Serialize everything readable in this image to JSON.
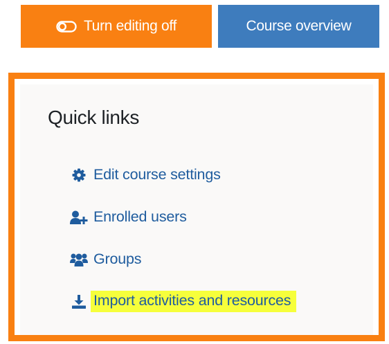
{
  "toolbar": {
    "edit_toggle": {
      "label": "Turn editing off",
      "icon": "toggle-icon",
      "color": "#f98012"
    },
    "course_overview": {
      "label": "Course overview",
      "color": "#3e7cbd"
    }
  },
  "quick_links": {
    "title": "Quick links",
    "border_color": "#f98012",
    "items": [
      {
        "label": "Edit course settings",
        "icon": "gear-icon"
      },
      {
        "label": "Enrolled users",
        "icon": "user-plus-icon"
      },
      {
        "label": "Groups",
        "icon": "users-icon"
      },
      {
        "label": "Import activities and resources",
        "icon": "download-icon",
        "highlight_color": "#f6ff3b"
      }
    ]
  },
  "link_color": "#1f5c9e"
}
